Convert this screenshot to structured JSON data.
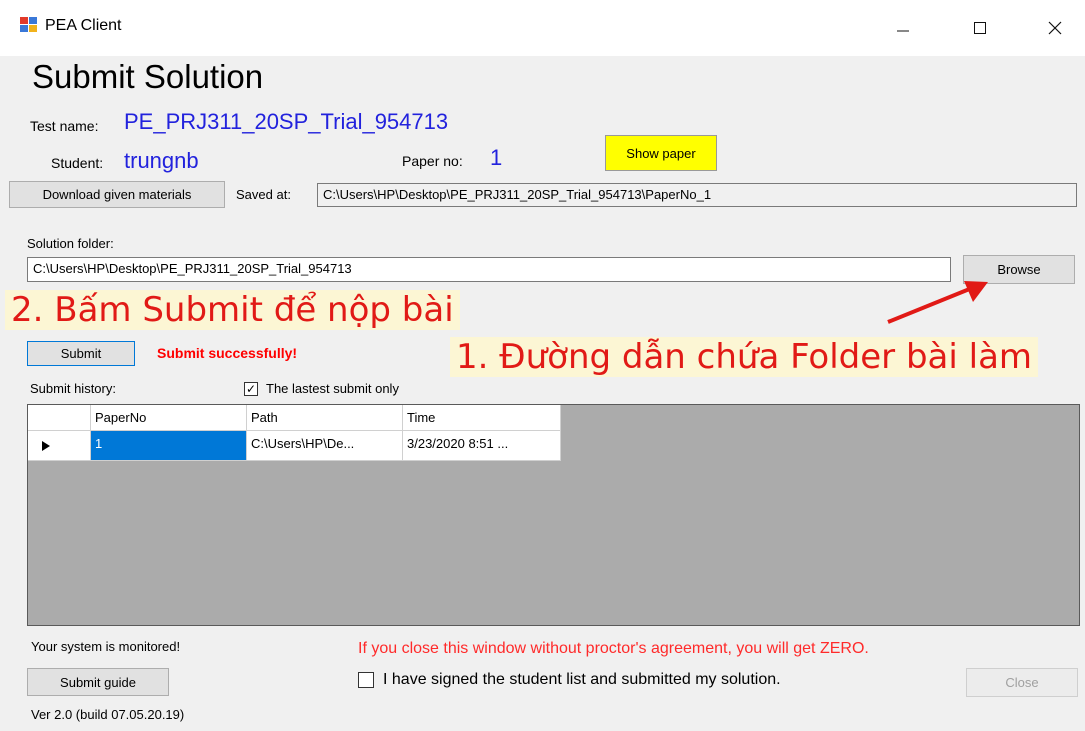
{
  "window": {
    "title": "PEA Client"
  },
  "header": {
    "heading": "Submit Solution"
  },
  "test": {
    "name_label": "Test name:",
    "name_value": "PE_PRJ311_20SP_Trial_954713"
  },
  "student": {
    "label": "Student:",
    "value": "trungnb"
  },
  "paper": {
    "label": "Paper no:",
    "value": "1",
    "show_button": "Show paper"
  },
  "download": {
    "button": "Download given materials",
    "saved_label": "Saved at:",
    "saved_value": "C:\\Users\\HP\\Desktop\\PE_PRJ311_20SP_Trial_954713\\PaperNo_1"
  },
  "solution": {
    "label": "Solution folder:",
    "value": "C:\\Users\\HP\\Desktop\\PE_PRJ311_20SP_Trial_954713",
    "browse_button": "Browse"
  },
  "annotations": {
    "step2": "2. Bấm Submit để nộp bài",
    "step1": "1. Đường dẫn chứa Folder bài làm",
    "color": "#e11a16"
  },
  "submit": {
    "button": "Submit",
    "status": "Submit successfully!"
  },
  "history": {
    "label": "Submit history:",
    "latest_only_label": "The lastest submit only",
    "latest_only_checked": true,
    "columns": [
      "PaperNo",
      "Path",
      "Time"
    ],
    "rows": [
      {
        "paperno": "1",
        "path": "C:\\Users\\HP\\De...",
        "time": "3/23/2020 8:51 ..."
      }
    ]
  },
  "footer": {
    "monitored": "Your system is monitored!",
    "warning": "If you close this window without proctor's agreement, you will get ZERO.",
    "guide_button": "Submit guide",
    "signed_label": "I have signed the student list and submitted my solution.",
    "signed_checked": false,
    "close_button": "Close",
    "version": "Ver 2.0 (build 07.05.20.19)"
  }
}
